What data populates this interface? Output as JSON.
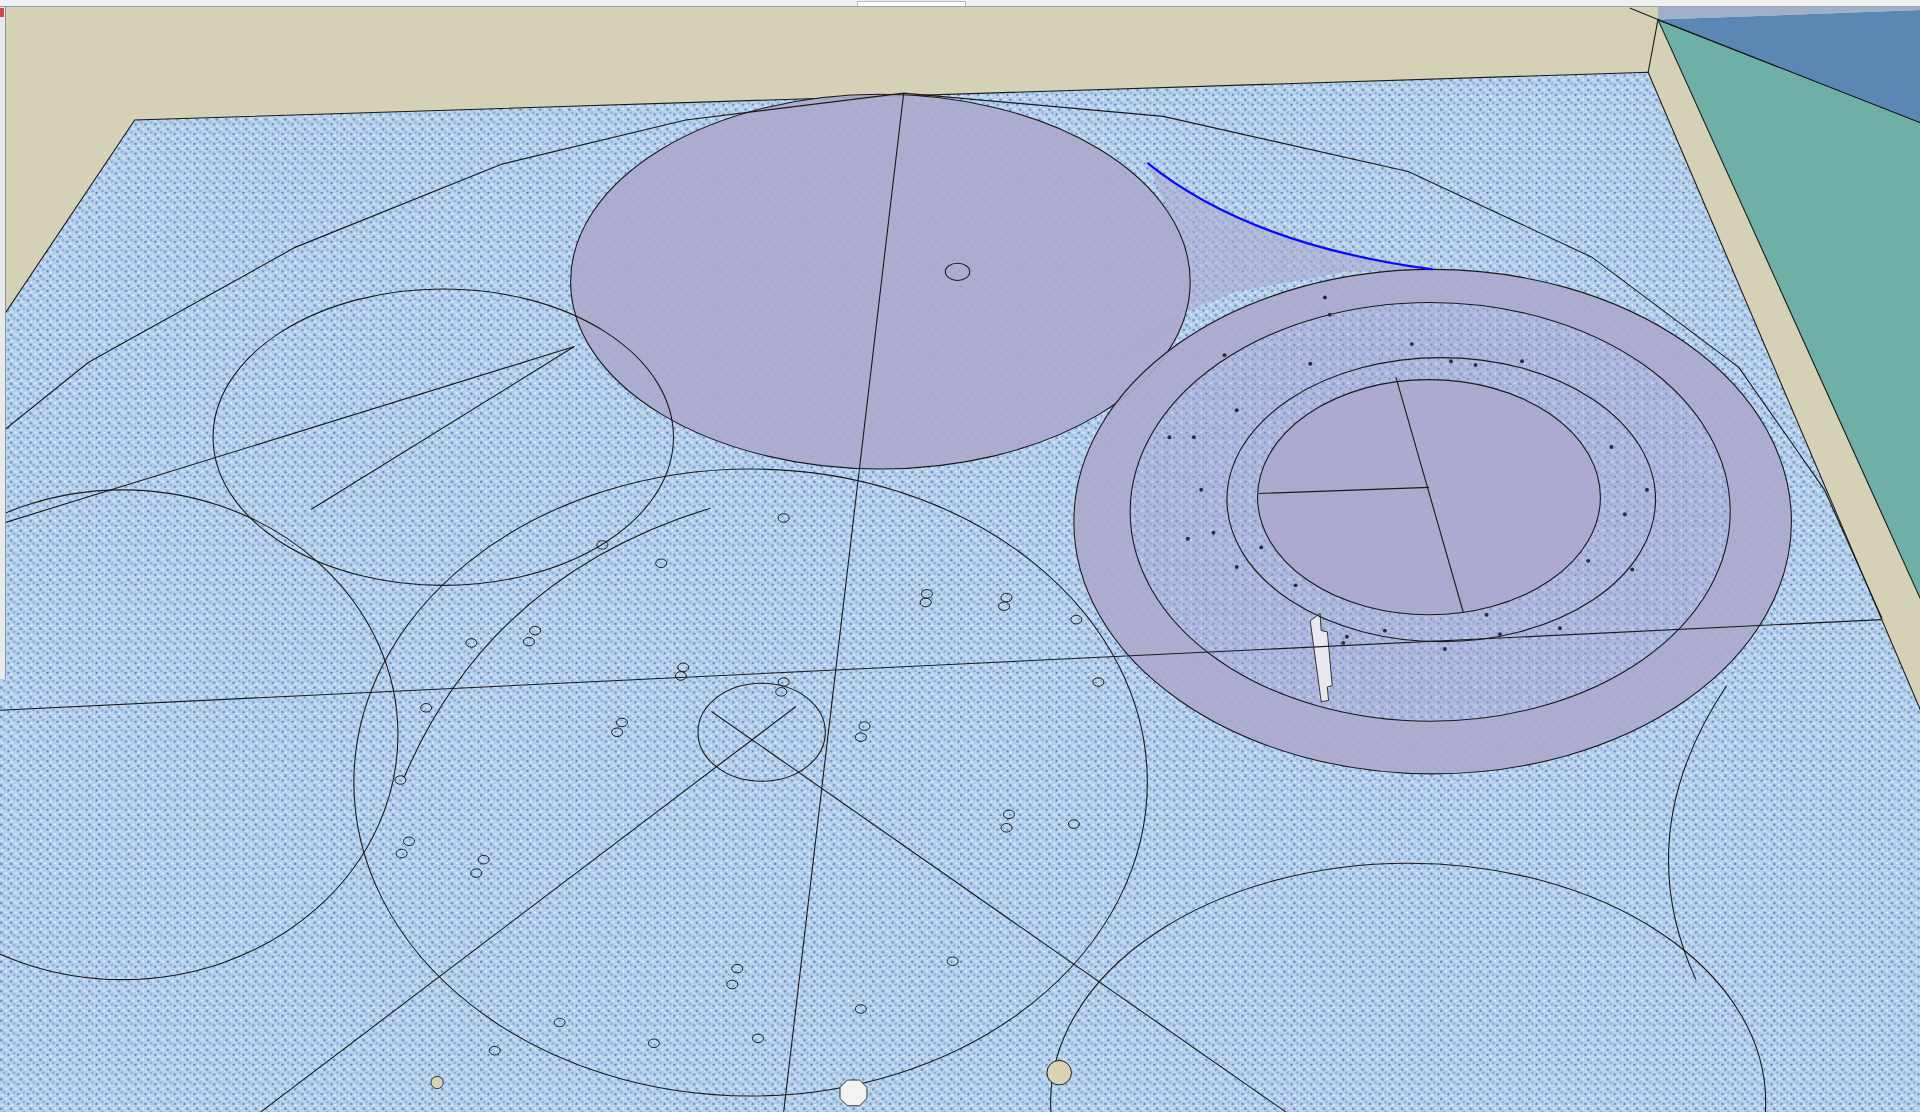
{
  "model": {
    "circles": [
      {
        "kind": "shaded"
      },
      {
        "kind": "outline"
      },
      {
        "kind": "outline"
      },
      {
        "kind": "outline"
      },
      {
        "kind": "outline"
      },
      {
        "kind": "shaded"
      },
      {
        "kind": "hazy"
      },
      {
        "kind": "outline"
      },
      {
        "kind": "shaded"
      },
      {
        "kind": "outline"
      }
    ],
    "arc": {
      "selected": true
    }
  }
}
